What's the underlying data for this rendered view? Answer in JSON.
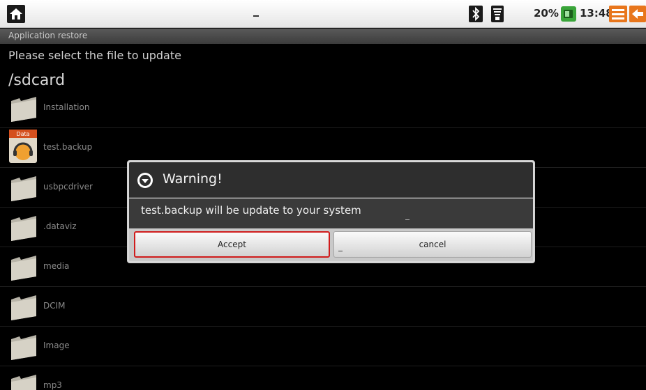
{
  "statusbar": {
    "battery_percent": "20%",
    "clock": "13:48",
    "icons": [
      "home-icon",
      "bluetooth-icon",
      "wifi-icon",
      "battery-icon",
      "menu-icon",
      "back-icon"
    ]
  },
  "app": {
    "title": "Application restore",
    "prompt": "Please select the file to update",
    "path": "/sdcard"
  },
  "files": [
    {
      "name": "Installation",
      "icon": "folder-icon"
    },
    {
      "name": "test.backup",
      "icon": "app-data-icon",
      "icon_label": "Data"
    },
    {
      "name": "usbpcdriver",
      "icon": "folder-icon"
    },
    {
      "name": ".dataviz",
      "icon": "folder-icon"
    },
    {
      "name": "media",
      "icon": "folder-icon"
    },
    {
      "name": "DCIM",
      "icon": "folder-icon"
    },
    {
      "name": "Image",
      "icon": "folder-icon"
    },
    {
      "name": "mp3",
      "icon": "folder-icon"
    }
  ],
  "dialog": {
    "title": "Warning!",
    "message": "test.backup will be update to your system",
    "accept_label": "Accept",
    "cancel_label": "cancel"
  },
  "colors": {
    "accent_highlight": "#d01c1c",
    "battery_green": "#3aa53a",
    "menu_orange": "#e8761c"
  }
}
